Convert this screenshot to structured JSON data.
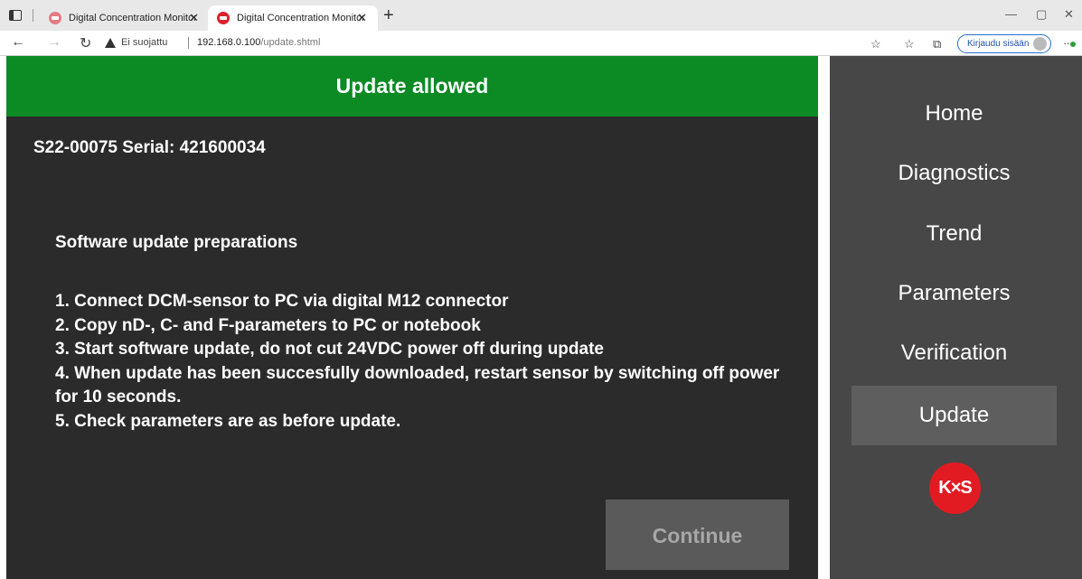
{
  "browser": {
    "tabs": [
      {
        "title": "Digital Concentration Monitor",
        "active": false
      },
      {
        "title": "Digital Concentration Monitor",
        "active": true
      }
    ],
    "security_label": "Ei suojattu",
    "url_host": "192.168.0.100",
    "url_path": "/update.shtml",
    "signin_label": "Kirjaudu sisään"
  },
  "banner": {
    "title": "Update allowed",
    "color": "#0c8a24"
  },
  "device": {
    "serial_line": "S22-00075 Serial: 421600034"
  },
  "instructions": {
    "title": "Software update preparations",
    "steps": [
      "1. Connect DCM-sensor to PC via digital M12 connector",
      "2. Copy nD-, C- and F-parameters to PC or notebook",
      "3. Start software update, do not cut 24VDC power off during update",
      "4. When update has been succesfully downloaded, restart sensor by switching off power for 10 seconds.",
      "5. Check parameters are as before update."
    ]
  },
  "continue_label": "Continue",
  "sidebar": {
    "items": [
      {
        "label": "Home"
      },
      {
        "label": "Diagnostics"
      },
      {
        "label": "Trend"
      },
      {
        "label": "Parameters"
      },
      {
        "label": "Verification"
      },
      {
        "label": "Update",
        "active": true
      }
    ],
    "logo_text": "K×S",
    "logo_color": "#e21b23"
  }
}
